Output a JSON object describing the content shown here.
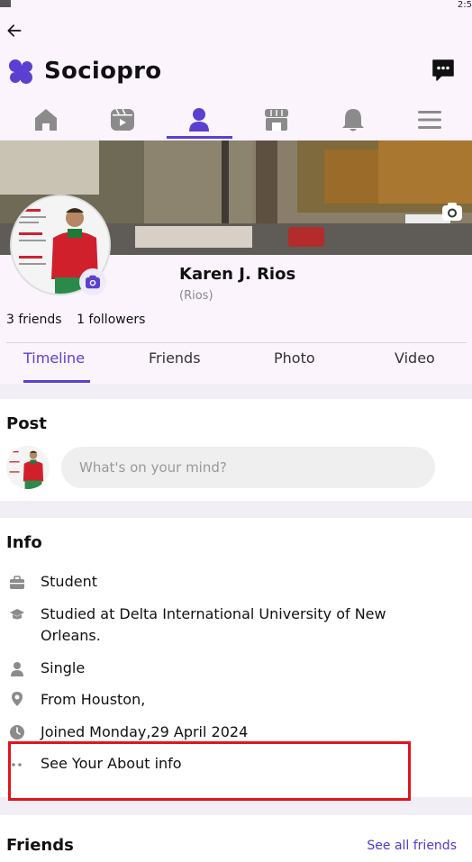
{
  "status": {
    "time": "2:5"
  },
  "app": {
    "name": "Sociopro"
  },
  "nav": [
    "home",
    "reels",
    "profile",
    "marketplace",
    "notifications",
    "menu"
  ],
  "profile": {
    "name": "Karen J. Rios",
    "handle": "(Rios)",
    "friends_count": "3 friends",
    "followers_count": "1 followers"
  },
  "tabs": [
    "Timeline",
    "Friends",
    "Photo",
    "Video"
  ],
  "post": {
    "title": "Post",
    "placeholder": "What's on your mind?"
  },
  "info": {
    "title": "Info",
    "items": [
      {
        "icon": "briefcase-icon",
        "text": "Student"
      },
      {
        "icon": "graduation-cap-icon",
        "text": "Studied at Delta International University of New Orleans."
      },
      {
        "icon": "person-icon",
        "text": "Single"
      },
      {
        "icon": "location-pin-icon",
        "text": "From Houston,"
      },
      {
        "icon": "clock-icon",
        "text": "Joined Monday,29 April 2024"
      },
      {
        "icon": "ellipsis-icon",
        "text": "See Your About info"
      }
    ]
  },
  "friends": {
    "title": "Friends",
    "see_all": "See all friends"
  },
  "colors": {
    "accent": "#5b3fd0",
    "nav_icon": "#8b8b8b",
    "highlight_box": "#e0141e"
  }
}
